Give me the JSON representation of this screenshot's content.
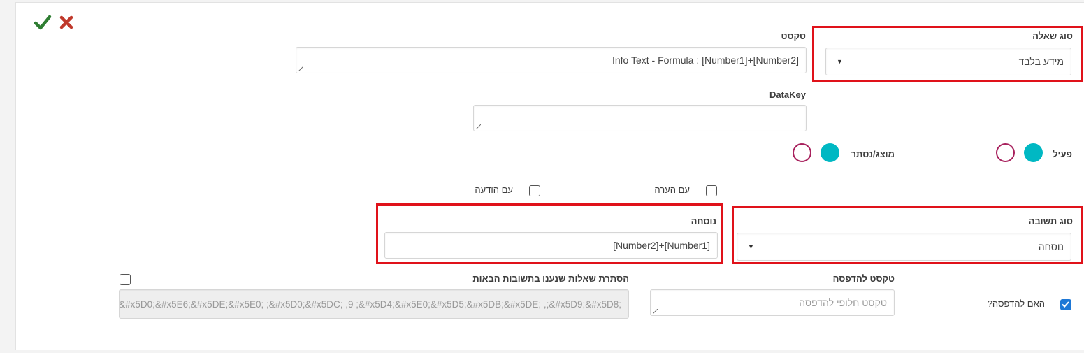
{
  "toolbar": {
    "confirm_icon": "check-icon",
    "cancel_icon": "close-icon",
    "confirm_color": "#2e7d32",
    "cancel_color": "#c0392b"
  },
  "question_type": {
    "label": "סוג שאלה",
    "value": "מידע בלבד"
  },
  "text": {
    "label": "טקסט",
    "value": "Info Text - Formula : [Number1]+[Number2]"
  },
  "datakey": {
    "label": "DataKey",
    "value": ""
  },
  "active": {
    "label": "פעיל"
  },
  "visibility": {
    "label": "מוצג/נסתר"
  },
  "options": {
    "with_note": "עם הערה",
    "with_message": "עם הודעה"
  },
  "answer_type": {
    "label": "סוג תשובה",
    "value": "נוסחה"
  },
  "formula": {
    "label": "נוסחה",
    "value": "[Number2]+[Number1]"
  },
  "print": {
    "checkbox_label": "האם להדפסה?",
    "checked": true
  },
  "print_text": {
    "label": "טקסט להדפסה",
    "placeholder": "טקסט חלופי להדפסה"
  },
  "hide_questions": {
    "label": "הסתרת שאלות שנענו בתשובות הבאות",
    "value": "&#x5D0;&#x5E6;&#x5DE;&#x5E0; ;&#x5D0;&#x5DC; ,9 ;&#x5D4;&#x5E0;&#x5D5;&#x5DB;&#x5DE; ,;&#x5D9;&#x5D8;"
  },
  "colors": {
    "highlight": "#e0121a",
    "radio_on": "#00b8c3",
    "radio_off_border": "#a8215d",
    "checkbox_checked": "#1e78d6"
  }
}
